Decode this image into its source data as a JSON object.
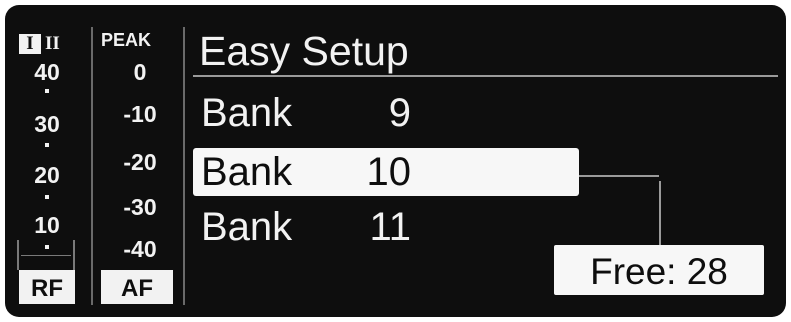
{
  "rf_meter": {
    "channel_1": "I",
    "channel_2": "II",
    "scale": [
      "40",
      "30",
      "20",
      "10"
    ],
    "label": "RF"
  },
  "af_meter": {
    "peak_label": "PEAK",
    "scale": [
      "0",
      "-10",
      "-20",
      "-30",
      "-40"
    ],
    "label": "AF"
  },
  "menu": {
    "title": "Easy Setup",
    "rows": [
      {
        "label": "Bank",
        "value": "9"
      },
      {
        "label": "Bank",
        "value": "10"
      },
      {
        "label": "Bank",
        "value": "11"
      }
    ],
    "selected_index": 1
  },
  "info": {
    "free": "Free: 28"
  },
  "colors": {
    "background": "#0e0e0e",
    "foreground": "#f2f2f2",
    "rule": "#9a9a9a"
  }
}
